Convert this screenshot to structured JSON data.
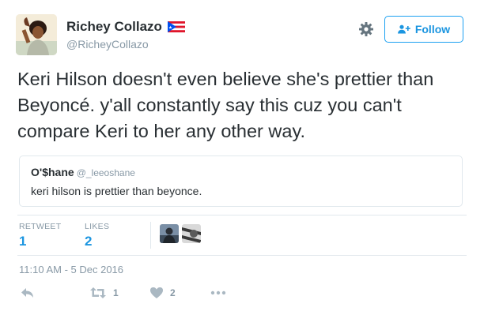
{
  "author": {
    "display_name": "Richey Collazo",
    "handle": "@RicheyCollazo",
    "flag_icon": "puerto-rico-flag-icon"
  },
  "header": {
    "follow_label": "Follow",
    "settings_icon": "gear-icon"
  },
  "tweet": {
    "text": "Keri Hilson doesn't even believe she's prettier than Beyoncé. y'all constantly say this cuz you can't compare Keri to her any other way."
  },
  "quoted_tweet": {
    "name": "O'$hane",
    "handle": "@_leeoshane",
    "text": "keri hilson is prettier than beyonce."
  },
  "stats": {
    "retweet_label": "RETWEET",
    "retweet_count": "1",
    "likes_label": "LIKES",
    "likes_count": "2"
  },
  "timestamp": "11:10 AM - 5 Dec 2016",
  "actions": {
    "reply_icon": "reply-icon",
    "retweet_icon": "retweet-icon",
    "retweet_count": "1",
    "like_icon": "heart-icon",
    "like_count": "2",
    "more_icon": "more-icon"
  },
  "colors": {
    "accent": "#1b95e0",
    "muted": "#8899a6",
    "border": "#e1e8ed",
    "text": "#292f33"
  }
}
